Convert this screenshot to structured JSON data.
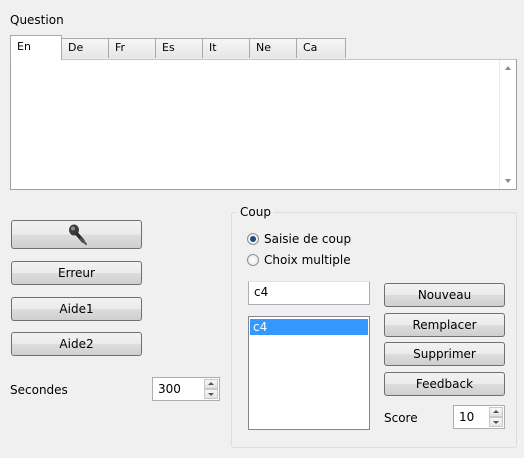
{
  "question_label": "Question",
  "tabs": [
    {
      "label": "En"
    },
    {
      "label": "De"
    },
    {
      "label": "Fr"
    },
    {
      "label": "Es"
    },
    {
      "label": "It"
    },
    {
      "label": "Ne"
    },
    {
      "label": "Ca"
    }
  ],
  "active_tab": "En",
  "question_text": "",
  "left_buttons": {
    "record_icon": "microphone-icon",
    "error": "Erreur",
    "help1": "Aide1",
    "help2": "Aide2"
  },
  "seconds": {
    "label": "Secondes",
    "value": "300"
  },
  "coup": {
    "title": "Coup",
    "radio_entry": "Saisie de coup",
    "radio_multiple": "Choix multiple",
    "selected_radio": "Saisie de coup",
    "move_input": "c4",
    "list_items": [
      "c4"
    ],
    "buttons": {
      "new": "Nouveau",
      "replace": "Remplacer",
      "delete": "Supprimer",
      "feedback": "Feedback"
    },
    "score": {
      "label": "Score",
      "value": "10"
    }
  },
  "colors": {
    "selection": "#3399ff",
    "background": "#f0f0f0"
  }
}
